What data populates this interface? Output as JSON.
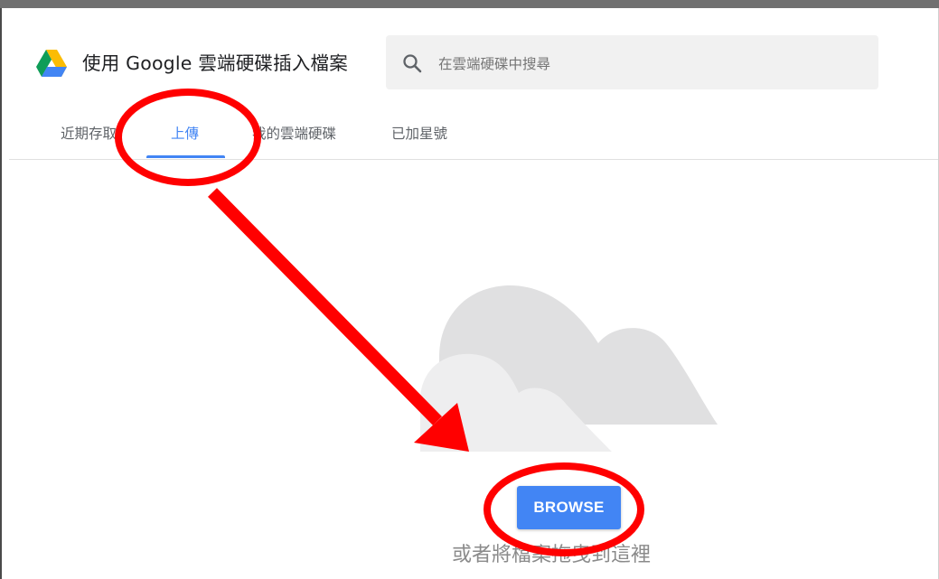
{
  "header": {
    "title": "使用 Google 雲端硬碟插入檔案",
    "logo_icon": "google-drive-icon",
    "search": {
      "icon": "search-icon",
      "placeholder": "在雲端硬碟中搜尋"
    }
  },
  "tabs": [
    {
      "label": "近期存取",
      "active": false
    },
    {
      "label": "上傳",
      "active": true
    },
    {
      "label": "我的雲端硬碟",
      "active": false
    },
    {
      "label": "已加星號",
      "active": false
    }
  ],
  "upload": {
    "illustration_icon": "clouds-icon",
    "browse_label": "BROWSE",
    "drop_hint": "或者將檔案拖曳到這裡"
  },
  "colors": {
    "accent": "#4285f4",
    "annotation": "#ff0000",
    "cloud_back": "#e0e0e0",
    "cloud_front": "#eeeeee",
    "top_bar": "#707070"
  },
  "annotations": {
    "upload_tab_circle": "red-ellipse",
    "browse_button_circle": "red-ellipse",
    "pointer_arrow": "red-arrow"
  }
}
